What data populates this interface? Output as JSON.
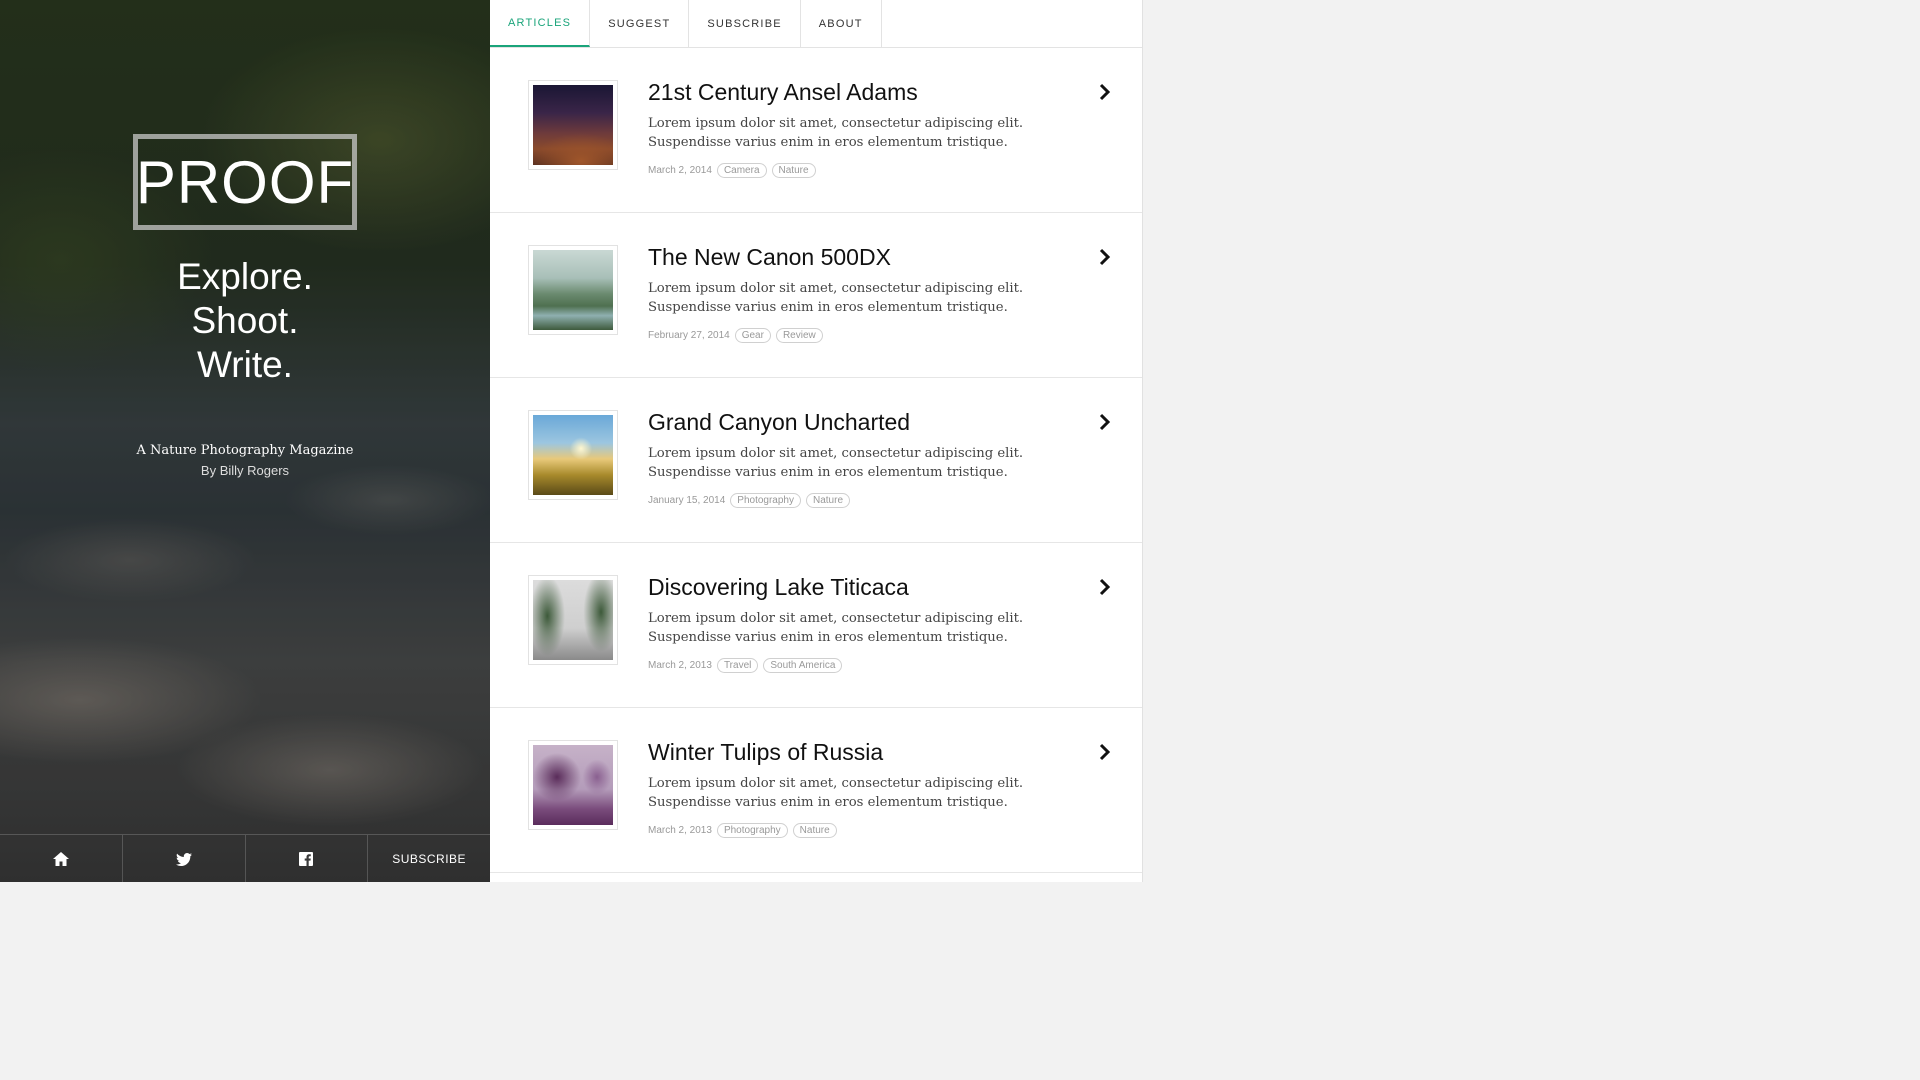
{
  "hero": {
    "logo": "PROOF",
    "tagline": [
      "Explore.",
      "Shoot.",
      "Write."
    ],
    "magazine": "A Nature Photography Magazine",
    "author": "By Billy Rogers",
    "footer": {
      "home_icon": "home-icon",
      "twitter_icon": "twitter-icon",
      "facebook_icon": "facebook-icon",
      "subscribe_label": "SUBSCRIBE"
    }
  },
  "nav": {
    "tabs": [
      {
        "label": "ARTICLES",
        "active": true
      },
      {
        "label": "SUGGEST",
        "active": false
      },
      {
        "label": "SUBSCRIBE",
        "active": false
      },
      {
        "label": "ABOUT",
        "active": false
      }
    ]
  },
  "colors": {
    "accent": "#1aa47a",
    "text": "#111111",
    "muted": "#999999"
  },
  "articles": [
    {
      "title": "21st Century Ansel Adams",
      "excerpt": "Lorem ipsum dolor sit amet, consectetur adipiscing elit. Suspendisse varius enim in eros elementum tristique.",
      "date": "March 2, 2014",
      "tags": [
        "Camera",
        "Nature"
      ]
    },
    {
      "title": "The New Canon 500DX",
      "excerpt": "Lorem ipsum dolor sit amet, consectetur adipiscing elit. Suspendisse varius enim in eros elementum tristique.",
      "date": "February 27, 2014",
      "tags": [
        "Gear",
        "Review"
      ]
    },
    {
      "title": "Grand Canyon Uncharted",
      "excerpt": "Lorem ipsum dolor sit amet, consectetur adipiscing elit. Suspendisse varius enim in eros elementum tristique.",
      "date": "January 15, 2014",
      "tags": [
        "Photography",
        "Nature"
      ]
    },
    {
      "title": "Discovering Lake Titicaca",
      "excerpt": "Lorem ipsum dolor sit amet, consectetur adipiscing elit. Suspendisse varius enim in eros elementum tristique.",
      "date": "March 2, 2013",
      "tags": [
        "Travel",
        "South America"
      ]
    },
    {
      "title": "Winter Tulips of Russia",
      "excerpt": "Lorem ipsum dolor sit amet, consectetur adipiscing elit. Suspendisse varius enim in eros elementum tristique.",
      "date": "March 2, 2013",
      "tags": [
        "Photography",
        "Nature"
      ]
    }
  ]
}
